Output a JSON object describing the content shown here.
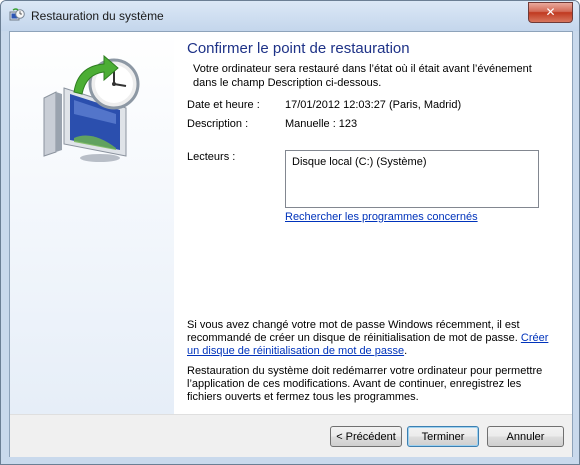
{
  "window": {
    "title": "Restauration du système",
    "close_glyph": "✕"
  },
  "page": {
    "heading": "Confirmer le point de restauration",
    "intro": "Votre ordinateur sera restauré dans l’état où il était avant l’événement dans le champ Description ci-dessous.",
    "date_label": "Date et heure :",
    "date_value": "17/01/2012 12:03:27 (Paris, Madrid)",
    "description_label": "Description :",
    "description_value": "Manuelle : 123",
    "drives_label": "Lecteurs :",
    "drives": [
      "Disque local (C:) (Système)"
    ],
    "affected_programs_link": "Rechercher les programmes concernés",
    "password_text": "Si vous avez changé votre mot de passe Windows récemment, il est recommandé de créer un disque de réinitialisation de mot de passe.",
    "password_link": "Créer un disque de réinitialisation de mot de passe",
    "restart_text": "Restauration du système doit redémarrer votre ordinateur pour permettre l’application de ces modifications. Avant de continuer, enregistrez les fichiers ouverts et fermez tous les programmes."
  },
  "buttons": {
    "back": "< Précédent",
    "finish": "Terminer",
    "cancel": "Annuler"
  },
  "icons": {
    "title": "system-restore-icon",
    "art": "computer-clock-restore-icon"
  },
  "colors": {
    "heading": "#1e3287",
    "link": "#0033bb",
    "close": "#c0391f"
  }
}
